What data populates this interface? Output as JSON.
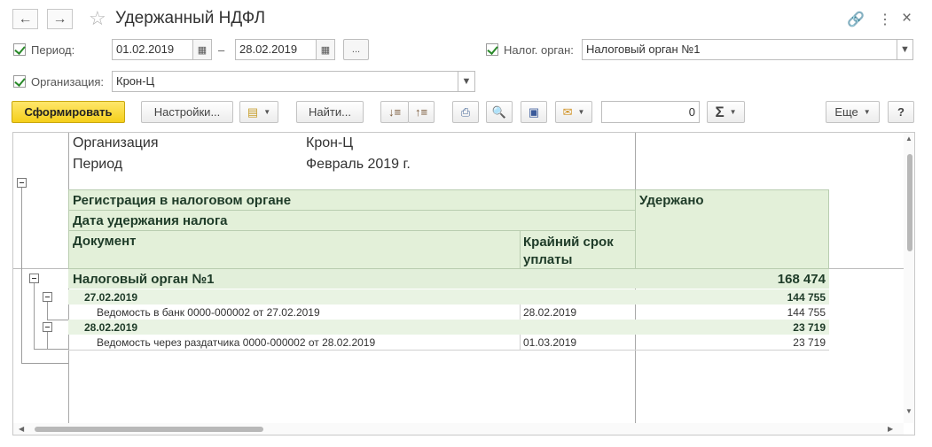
{
  "window": {
    "title": "Удержанный НДФЛ",
    "back_icon": "←",
    "forward_icon": "→",
    "star_icon": "☆",
    "link_icon": "🔗",
    "more_icon": "⋮",
    "close_icon": "×"
  },
  "filters": {
    "period_label": "Период:",
    "period_from": "01.02.2019",
    "period_dash": "–",
    "period_to": "28.02.2019",
    "period_choose": "...",
    "tax_authority_label": "Налог. орган:",
    "tax_authority_value": "Налоговый орган №1",
    "organization_label": "Организация:",
    "organization_value": "Крон-Ц"
  },
  "toolbar": {
    "generate": "Сформировать",
    "settings": "Настройки...",
    "find": "Найти...",
    "sum_value": "0",
    "sum_symbol": "Σ",
    "more": "Еще",
    "help": "?"
  },
  "report": {
    "org_label": "Организация",
    "org_value": "Крон-Ц",
    "period_label": "Период",
    "period_value": "Февраль 2019 г.",
    "headers": {
      "registration": "Регистрация в налоговом органе",
      "date": "Дата удержания налога",
      "document": "Документ",
      "deadline": "Крайний срок уплаты",
      "withheld": "Удержано"
    },
    "group": {
      "name": "Налоговый орган №1",
      "total": "168 474"
    },
    "subgroups": [
      {
        "date": "27.02.2019",
        "total": "144 755",
        "document": "Ведомость в банк 0000-000002 от 27.02.2019",
        "deadline": "28.02.2019",
        "amount": "144 755"
      },
      {
        "date": "28.02.2019",
        "total": "23 719",
        "document": "Ведомость через раздатчика 0000-000002 от 28.02.2019",
        "deadline": "01.03.2019",
        "amount": "23 719"
      }
    ]
  }
}
